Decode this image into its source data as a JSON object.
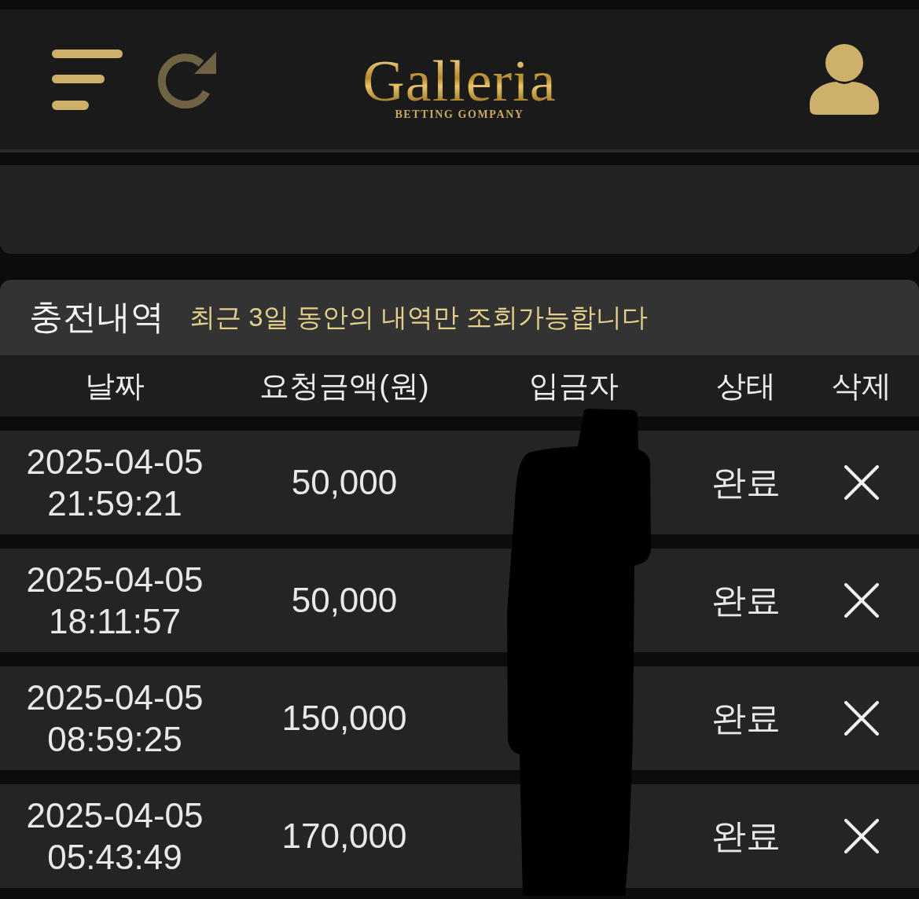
{
  "header": {
    "logo": {
      "title": "Galleria",
      "subtitle": "BETTING GOMPANY"
    }
  },
  "history": {
    "title": "충전내역",
    "note": "최근 3일 동안의 내역만 조회가능합니다",
    "columns": [
      "날짜",
      "요청금액(원)",
      "입금자",
      "상태",
      "삭제"
    ],
    "depositor_redacted": true,
    "rows": [
      {
        "date": "2025-04-05",
        "time": "21:59:21",
        "amount": "50,000",
        "status": "완료"
      },
      {
        "date": "2025-04-05",
        "time": "18:11:57",
        "amount": "50,000",
        "status": "완료"
      },
      {
        "date": "2025-04-05",
        "time": "08:59:25",
        "amount": "150,000",
        "status": "완료"
      },
      {
        "date": "2025-04-05",
        "time": "05:43:49",
        "amount": "170,000",
        "status": "완료"
      }
    ]
  }
}
